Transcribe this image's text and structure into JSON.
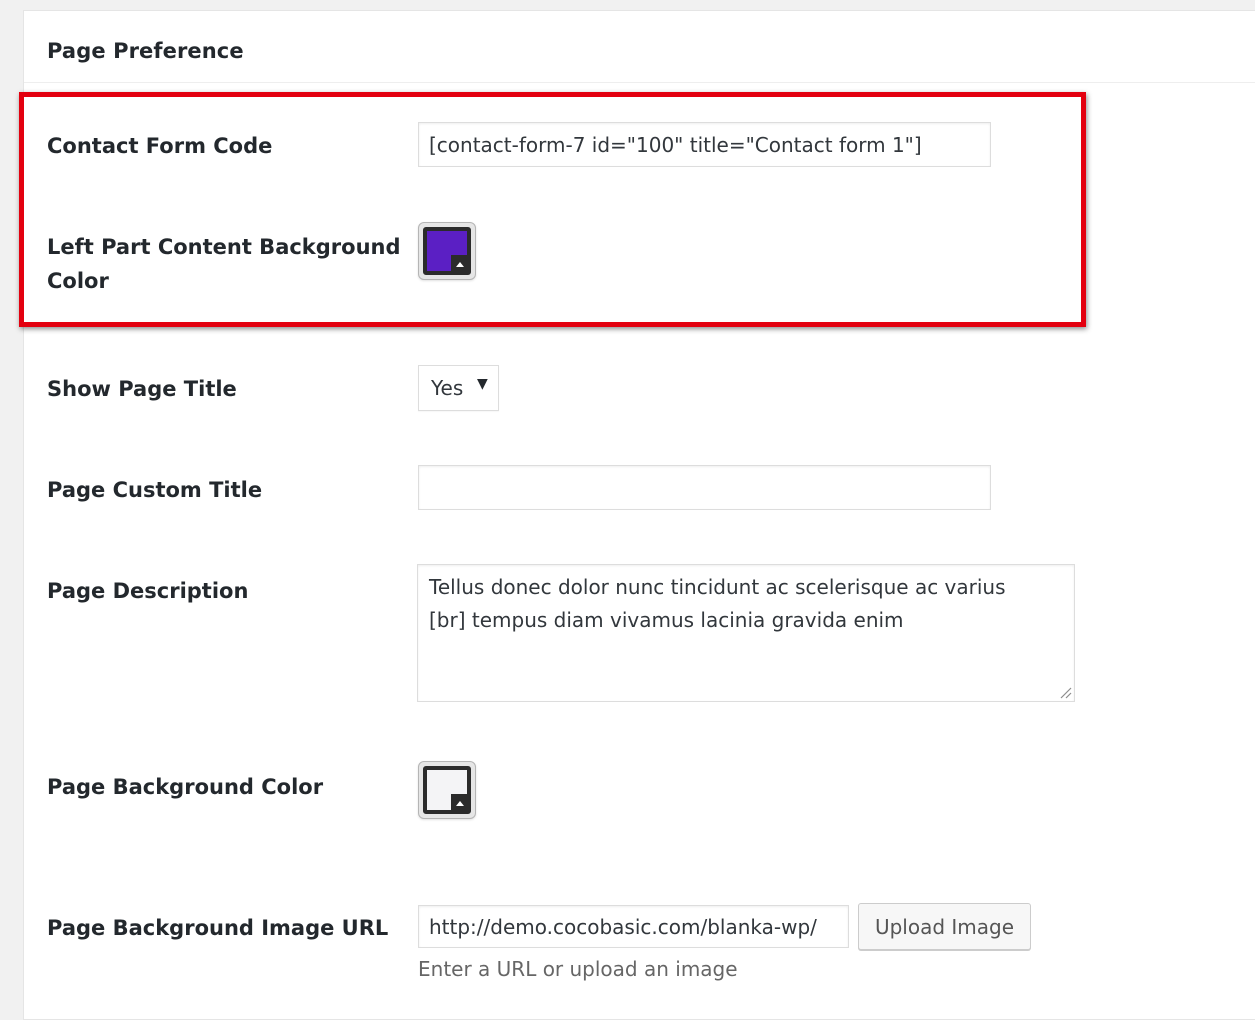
{
  "panel": {
    "title": "Page Preference"
  },
  "fields": {
    "contact_form_code": {
      "label": "Contact Form Code",
      "value": "[contact-form-7 id=\"100\" title=\"Contact form 1\"]"
    },
    "left_part_bg_color": {
      "label_line1": "Left Part Content Background",
      "label_line2": "Color",
      "color": "#5b1fc4"
    },
    "show_page_title": {
      "label": "Show Page Title",
      "selected": "Yes",
      "arrow": "▼"
    },
    "page_custom_title": {
      "label": "Page Custom Title",
      "value": ""
    },
    "page_description": {
      "label": "Page Description",
      "line1": "Tellus donec dolor nunc tincidunt ac scelerisque ac varius",
      "line2": "[br] tempus diam vivamus lacinia gravida enim"
    },
    "page_bg_color": {
      "label": "Page Background Color",
      "color": "#f4f4f6"
    },
    "page_bg_image_url": {
      "label": "Page Background Image URL",
      "value": "http://demo.cocobasic.com/blanka-wp/",
      "button_label": "Upload Image",
      "hint": "Enter a URL or upload an image"
    }
  },
  "highlight_color": "#e3000f",
  "icons": {
    "select_arrow": "caret-down-icon",
    "color_picker": "color-picker-icon",
    "resize": "resize-grip-icon"
  }
}
